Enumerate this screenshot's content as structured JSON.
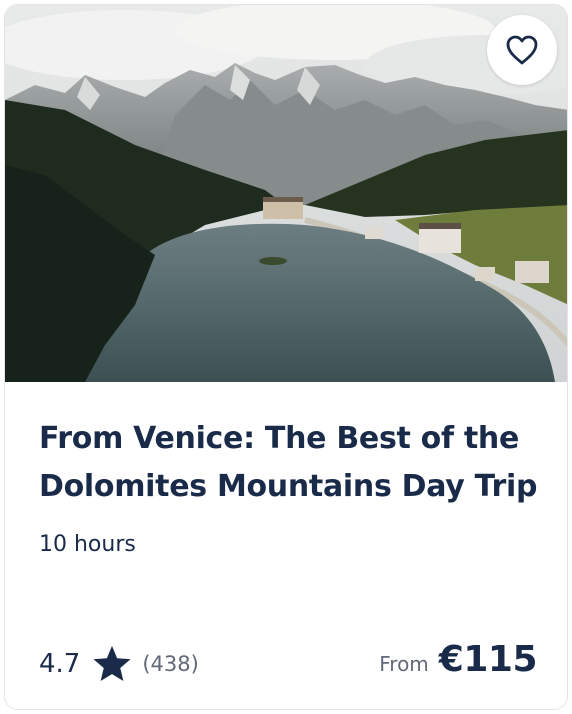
{
  "card": {
    "image_alt": "Lake Misurina with Dolomites mountains",
    "wishlist_icon": "heart-outline-icon",
    "title": "From Venice: The Best of the Dolomites Mountains Day Trip",
    "duration": "10 hours",
    "rating": {
      "value": "4.7",
      "icon": "star-icon",
      "count": "(438)"
    },
    "price": {
      "from_label": "From",
      "value": "€115"
    }
  },
  "colors": {
    "text_primary": "#1a2b49",
    "text_secondary": "#63687a",
    "border": "#e2e4e8"
  }
}
